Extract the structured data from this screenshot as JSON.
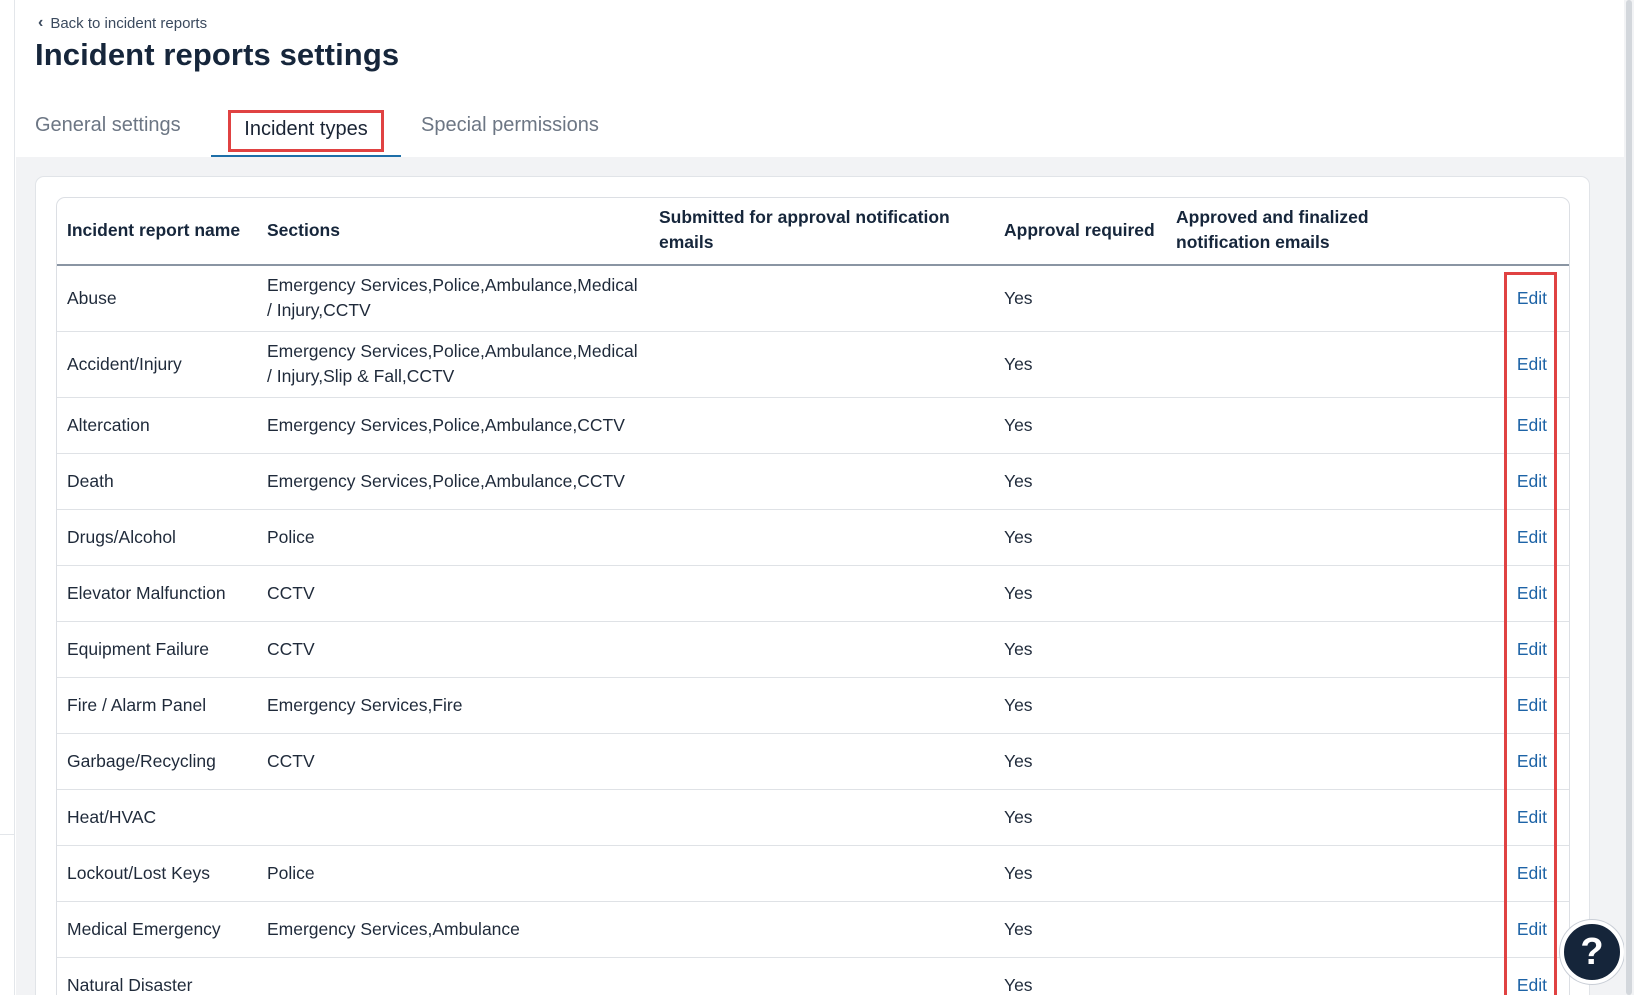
{
  "back_link": {
    "label": "Back to incident reports"
  },
  "page_title": "Incident reports settings",
  "tabs": [
    {
      "label": "General settings",
      "active": false
    },
    {
      "label": "Incident types",
      "active": true
    },
    {
      "label": "Special permissions",
      "active": false
    }
  ],
  "table": {
    "headers": {
      "name": "Incident report name",
      "sections": "Sections",
      "submitted_emails": "Submitted for approval notification emails",
      "approval": "Approval required",
      "approved_emails": "Approved and finalized notification emails"
    },
    "edit_label": "Edit",
    "rows": [
      {
        "name": "Abuse",
        "sections": "Emergency Services,Police,Ambulance,Medical / Injury,CCTV",
        "submitted": "",
        "approval": "Yes",
        "approved": ""
      },
      {
        "name": "Accident/Injury",
        "sections": "Emergency Services,Police,Ambulance,Medical / Injury,Slip & Fall,CCTV",
        "submitted": "",
        "approval": "Yes",
        "approved": ""
      },
      {
        "name": "Altercation",
        "sections": "Emergency Services,Police,Ambulance,CCTV",
        "submitted": "",
        "approval": "Yes",
        "approved": ""
      },
      {
        "name": "Death",
        "sections": "Emergency Services,Police,Ambulance,CCTV",
        "submitted": "",
        "approval": "Yes",
        "approved": ""
      },
      {
        "name": "Drugs/Alcohol",
        "sections": "Police",
        "submitted": "",
        "approval": "Yes",
        "approved": ""
      },
      {
        "name": "Elevator Malfunction",
        "sections": "CCTV",
        "submitted": "",
        "approval": "Yes",
        "approved": ""
      },
      {
        "name": "Equipment Failure",
        "sections": "CCTV",
        "submitted": "",
        "approval": "Yes",
        "approved": ""
      },
      {
        "name": "Fire / Alarm Panel",
        "sections": "Emergency Services,Fire",
        "submitted": "",
        "approval": "Yes",
        "approved": ""
      },
      {
        "name": "Garbage/Recycling",
        "sections": "CCTV",
        "submitted": "",
        "approval": "Yes",
        "approved": ""
      },
      {
        "name": "Heat/HVAC",
        "sections": "",
        "submitted": "",
        "approval": "Yes",
        "approved": ""
      },
      {
        "name": "Lockout/Lost Keys",
        "sections": "Police",
        "submitted": "",
        "approval": "Yes",
        "approved": ""
      },
      {
        "name": "Medical Emergency",
        "sections": "Emergency Services,Ambulance",
        "submitted": "",
        "approval": "Yes",
        "approved": ""
      },
      {
        "name": "Natural Disaster",
        "sections": "",
        "submitted": "",
        "approval": "Yes",
        "approved": ""
      }
    ]
  },
  "help_button": {
    "label": "?"
  },
  "colors": {
    "accent_link": "#1d63a6",
    "highlight_box": "#e04242",
    "title_text": "#16263b",
    "help_button_bg": "#15253a",
    "tab_underline": "#1d6ea8"
  },
  "icons": {
    "back": "chevron-left-icon",
    "help": "question-mark-icon"
  }
}
